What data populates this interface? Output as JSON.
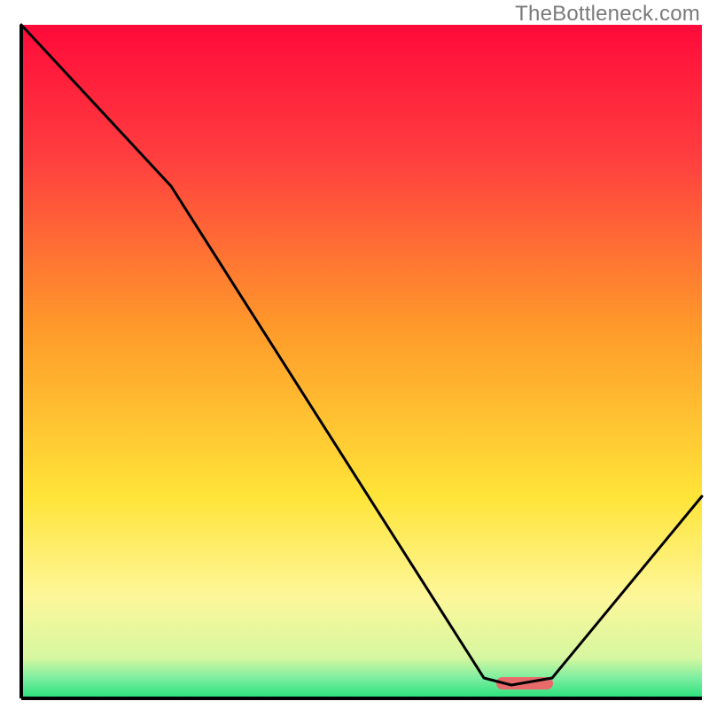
{
  "watermark": "TheBottleneck.com",
  "chart_data": {
    "type": "line",
    "title": "",
    "xlabel": "",
    "ylabel": "",
    "xlim": [
      0,
      100
    ],
    "ylim": [
      0,
      100
    ],
    "grid": false,
    "legend": false,
    "description": "Bottleneck percentage curve over a red-yellow-green gradient; minimum bottleneck near x≈72. Thin green band at bottom; small red/salmon marker at the curve minimum.",
    "series": [
      {
        "name": "bottleneck-curve",
        "x": [
          0,
          22,
          68,
          72,
          78,
          100
        ],
        "values": [
          100,
          76,
          3,
          2,
          3,
          30
        ]
      }
    ],
    "optimal_marker": {
      "x_start": 70,
      "x_end": 78,
      "y": 2
    },
    "gradient_stops": [
      {
        "pct": 0,
        "color": "#ff0a3a"
      },
      {
        "pct": 20,
        "color": "#ff3f3f"
      },
      {
        "pct": 45,
        "color": "#ff9a2a"
      },
      {
        "pct": 70,
        "color": "#ffe438"
      },
      {
        "pct": 85,
        "color": "#fdf79a"
      },
      {
        "pct": 94,
        "color": "#d6f7a0"
      },
      {
        "pct": 97,
        "color": "#7ceea0"
      },
      {
        "pct": 100,
        "color": "#27e07a"
      }
    ],
    "colors": {
      "curve": "#000000",
      "marker": "#e86a6a",
      "axis": "#000000"
    }
  }
}
